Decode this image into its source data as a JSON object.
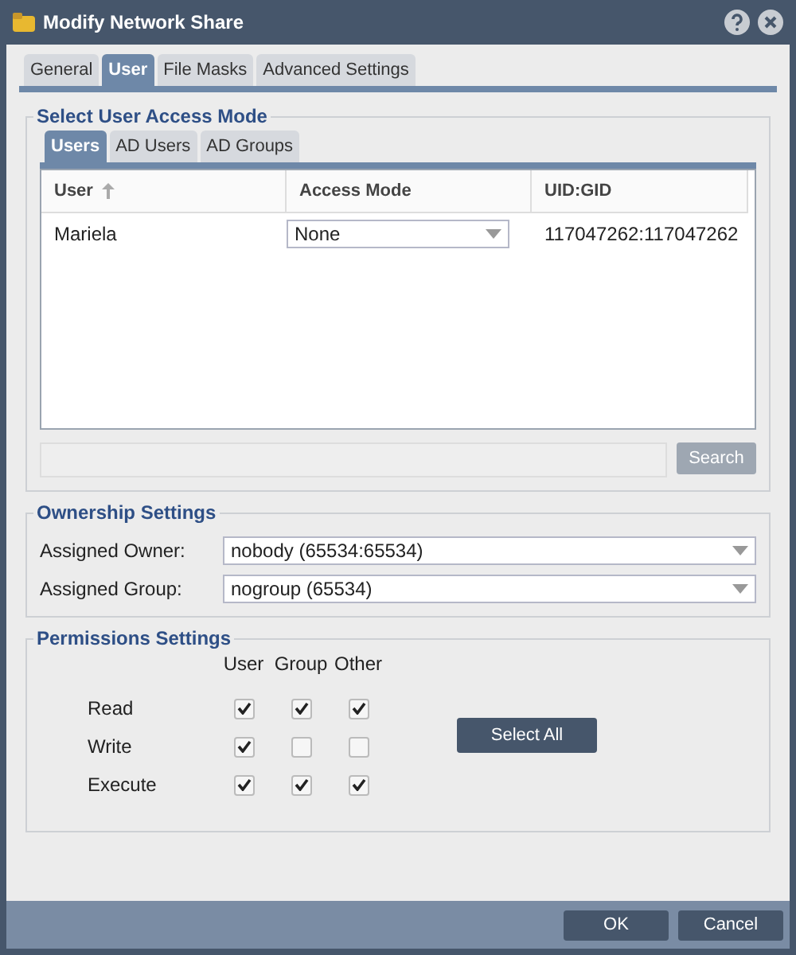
{
  "window": {
    "title": "Modify Network Share"
  },
  "tabs": [
    {
      "label": "General",
      "selected": false
    },
    {
      "label": "User",
      "selected": true
    },
    {
      "label": "File Masks",
      "selected": false
    },
    {
      "label": "Advanced Settings",
      "selected": false
    }
  ],
  "access_mode": {
    "legend": "Select User Access Mode",
    "tabs": [
      {
        "label": "Users",
        "selected": true
      },
      {
        "label": "AD Users",
        "selected": false
      },
      {
        "label": "AD Groups",
        "selected": false
      }
    ],
    "table": {
      "columns": [
        "User",
        "Access Mode",
        "UID:GID"
      ],
      "rows": [
        {
          "user": "Mariela",
          "access_mode": "None",
          "uid_gid": "117047262:117047262"
        }
      ]
    },
    "search_button": {
      "label": "Search",
      "disabled": true
    }
  },
  "ownership": {
    "legend": "Ownership Settings",
    "fields": [
      {
        "label": "Assigned Owner:",
        "value": "nobody (65534:65534)"
      },
      {
        "label": "Assigned Group:",
        "value": "nogroup (65534)"
      }
    ]
  },
  "permissions": {
    "legend": "Permissions Settings",
    "columns": [
      "User",
      "Group",
      "Other"
    ],
    "rows": [
      {
        "label": "Read",
        "checks": [
          {
            "checked": true
          },
          {
            "checked": true
          },
          {
            "checked": true
          }
        ]
      },
      {
        "label": "Write",
        "checks": [
          {
            "checked": true
          },
          {
            "checked": false
          },
          {
            "checked": false
          }
        ]
      },
      {
        "label": "Execute",
        "checks": [
          {
            "checked": true
          },
          {
            "checked": true
          },
          {
            "checked": true
          }
        ]
      }
    ],
    "select_all": "Select All"
  },
  "buttons": [
    "OK",
    "Cancel"
  ]
}
